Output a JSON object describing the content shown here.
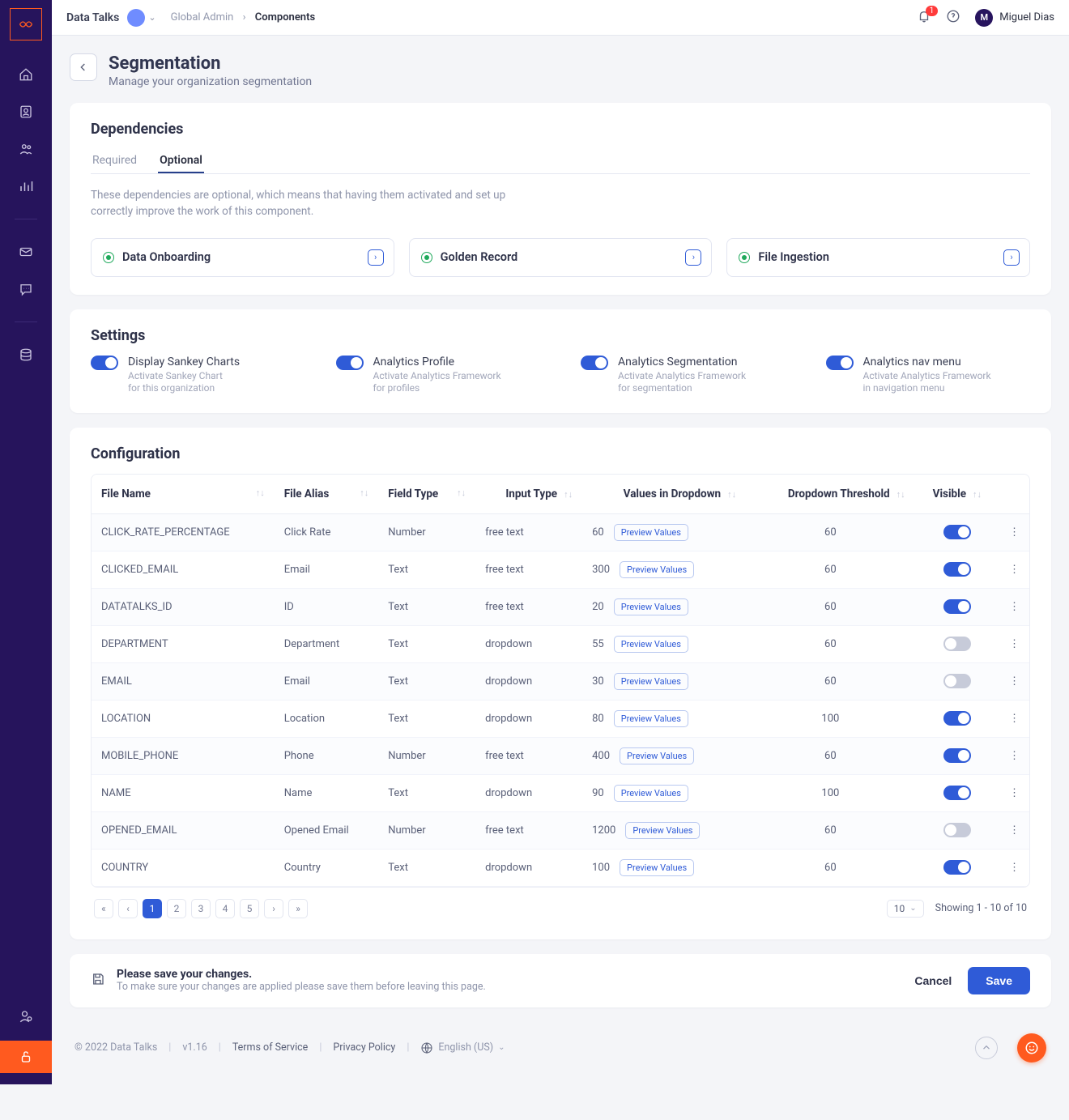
{
  "brand": "Data Talks",
  "breadcrumbs": {
    "parent": "Global Admin",
    "current": "Components"
  },
  "notifications": "1",
  "user": {
    "initial": "M",
    "name": "Miguel Dias"
  },
  "page": {
    "title": "Segmentation",
    "subtitle": "Manage your organization segmentation"
  },
  "dependencies": {
    "heading": "Dependencies",
    "tabs": {
      "required": "Required",
      "optional": "Optional"
    },
    "description": "These dependencies are optional, which means that having them activated and set up correctly improve the work of this component.",
    "items": [
      "Data Onboarding",
      "Golden Record",
      "File Ingestion"
    ]
  },
  "settings": {
    "heading": "Settings",
    "items": [
      {
        "title": "Display Sankey Charts",
        "sub1": "Activate Sankey Chart",
        "sub2": "for this organization"
      },
      {
        "title": "Analytics Profile",
        "sub1": "Activate Analytics Framework",
        "sub2": "for profiles"
      },
      {
        "title": "Analytics Segmentation",
        "sub1": "Activate Analytics Framework",
        "sub2": "for segmentation"
      },
      {
        "title": "Analytics nav menu",
        "sub1": "Activate Analytics Framework",
        "sub2": "in navigation menu"
      }
    ]
  },
  "configuration": {
    "heading": "Configuration",
    "columns": {
      "fileName": "File Name",
      "fileAlias": "File Alias",
      "fieldType": "Field Type",
      "inputType": "Input Type",
      "valuesInDropdown": "Values in Dropdown",
      "dropdownThreshold": "Dropdown Threshold",
      "visible": "Visible"
    },
    "previewLabel": "Preview Values",
    "rows": [
      {
        "fileName": "CLICK_RATE_PERCENTAGE",
        "fileAlias": "Click Rate",
        "fieldType": "Number",
        "inputType": "free text",
        "values": "60",
        "threshold": "60",
        "visible": true
      },
      {
        "fileName": "CLICKED_EMAIL",
        "fileAlias": "Email",
        "fieldType": "Text",
        "inputType": "free text",
        "values": "300",
        "threshold": "60",
        "visible": true
      },
      {
        "fileName": "DATATALKS_ID",
        "fileAlias": "ID",
        "fieldType": "Text",
        "inputType": "free text",
        "values": "20",
        "threshold": "60",
        "visible": true
      },
      {
        "fileName": "DEPARTMENT",
        "fileAlias": "Department",
        "fieldType": "Text",
        "inputType": "dropdown",
        "values": "55",
        "threshold": "60",
        "visible": false
      },
      {
        "fileName": "EMAIL",
        "fileAlias": "Email",
        "fieldType": "Text",
        "inputType": "dropdown",
        "values": "30",
        "threshold": "60",
        "visible": false
      },
      {
        "fileName": "LOCATION",
        "fileAlias": "Location",
        "fieldType": "Text",
        "inputType": "dropdown",
        "values": "80",
        "threshold": "100",
        "visible": true
      },
      {
        "fileName": "MOBILE_PHONE",
        "fileAlias": "Phone",
        "fieldType": "Number",
        "inputType": "free text",
        "values": "400",
        "threshold": "60",
        "visible": true
      },
      {
        "fileName": "NAME",
        "fileAlias": "Name",
        "fieldType": "Text",
        "inputType": "dropdown",
        "values": "90",
        "threshold": "100",
        "visible": true
      },
      {
        "fileName": "OPENED_EMAIL",
        "fileAlias": "Opened Email",
        "fieldType": "Number",
        "inputType": "free text",
        "values": "1200",
        "threshold": "60",
        "visible": false
      },
      {
        "fileName": "COUNTRY",
        "fileAlias": "Country",
        "fieldType": "Text",
        "inputType": "dropdown",
        "values": "100",
        "threshold": "60",
        "visible": true
      }
    ],
    "pagination": {
      "pages": [
        "1",
        "2",
        "3",
        "4",
        "5"
      ],
      "perPage": "10",
      "showing": "Showing 1 - 10 of 10"
    }
  },
  "savebar": {
    "title": "Please save your changes.",
    "subtitle": "To make sure your changes are applied please save them before leaving this page.",
    "cancel": "Cancel",
    "save": "Save"
  },
  "footer": {
    "copyright": "© 2022 Data Talks",
    "version": "v1.16",
    "terms": "Terms of Service",
    "privacy": "Privacy Policy",
    "language": "English (US)"
  }
}
